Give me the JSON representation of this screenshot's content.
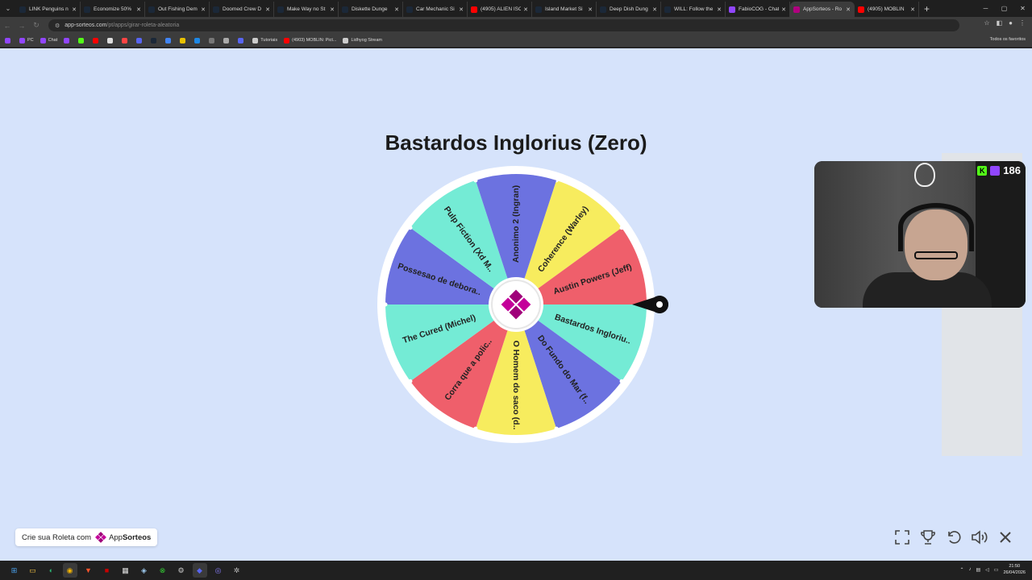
{
  "browser": {
    "tabs": [
      {
        "title": "LINK Penguins n",
        "color": "#1b2838"
      },
      {
        "title": "Economize 50%",
        "color": "#1b2838"
      },
      {
        "title": "Out Fishing Dem",
        "color": "#1b2838"
      },
      {
        "title": "Doomed Crew D",
        "color": "#1b2838"
      },
      {
        "title": "Make Way no St",
        "color": "#1b2838"
      },
      {
        "title": "Diskette Dunge",
        "color": "#1b2838"
      },
      {
        "title": "Car Mechanic Si",
        "color": "#1b2838"
      },
      {
        "title": "(4905) ALIEN ISO",
        "color": "#ff0000"
      },
      {
        "title": "Island Market Si",
        "color": "#1b2838"
      },
      {
        "title": "Deep Dish Dung",
        "color": "#1b2838"
      },
      {
        "title": "WILL: Follow the",
        "color": "#1b2838"
      },
      {
        "title": "FabioCOG - Chat",
        "color": "#9146ff"
      },
      {
        "title": "AppSorteos - Ro",
        "color": "#b0007f",
        "active": true
      },
      {
        "title": "(4905) MOBLIN",
        "color": "#ff0000"
      }
    ],
    "url_host": "app-sorteos.com",
    "url_path": "/pt/apps/girar-roleta-aleatoria",
    "bookmarks": [
      {
        "label": "",
        "color": "#9146ff"
      },
      {
        "label": "PC",
        "color": "#9146ff"
      },
      {
        "label": "Chat",
        "color": "#9146ff"
      },
      {
        "label": "",
        "color": "#9146ff"
      },
      {
        "label": "",
        "color": "#53fc18"
      },
      {
        "label": "",
        "color": "#ff0000"
      },
      {
        "label": "",
        "color": "#dddddd"
      },
      {
        "label": "",
        "color": "#ff4444"
      },
      {
        "label": "",
        "color": "#5865f2"
      },
      {
        "label": "",
        "color": "#1b2838"
      },
      {
        "label": "",
        "color": "#4285f4"
      },
      {
        "label": "",
        "color": "#e8c100"
      },
      {
        "label": "",
        "color": "#1e88e5"
      },
      {
        "label": "",
        "color": "#777777"
      },
      {
        "label": "",
        "color": "#aaaaaa"
      },
      {
        "label": "",
        "color": "#5865f2"
      },
      {
        "label": "Tutoriais",
        "color": "#cccccc"
      },
      {
        "label": "(4903) MOBLIN: Pict...",
        "color": "#ff0000"
      },
      {
        "label": "Lidhyog Stream",
        "color": "#cccccc"
      }
    ],
    "all_bookmarks": "Todos os favoritos"
  },
  "roleta": {
    "title": "Bastardos Inglorius (Zero)",
    "segments": [
      {
        "label": "Coherence (Warley)",
        "color": "#f7ec5e"
      },
      {
        "label": "Austin Powers (Jeff)",
        "color": "#ef5f6b"
      },
      {
        "label": "Bastardos Ingloriu..",
        "color": "#74ebd5"
      },
      {
        "label": "Do Fundo do Mar (f..",
        "color": "#6c72e0"
      },
      {
        "label": "O Homem do saco (d..",
        "color": "#f7ec5e"
      },
      {
        "label": "Corra que a polic..",
        "color": "#ef5f6b"
      },
      {
        "label": "The Cured (Michel)",
        "color": "#74ebd5"
      },
      {
        "label": "Possesao de debora..",
        "color": "#6c72e0"
      },
      {
        "label": "Pulp Fiction (Xd M..",
        "color": "#74ebd5"
      },
      {
        "label": "Anonimo 2 (Ingran)",
        "color": "#6c72e0"
      }
    ],
    "center_color": "#a0007a",
    "pointer_color": "#111111"
  },
  "webcam": {
    "viewer_count": "186",
    "kick_glyph": "K"
  },
  "promo": {
    "text": "Crie sua Roleta com",
    "brand_plain": "App",
    "brand_bold": "Sorteos"
  },
  "controls": [
    "fullscreen-icon",
    "trophy-icon",
    "reset-icon",
    "volume-icon",
    "close-icon"
  ],
  "taskbar": {
    "time": "21:50",
    "date": "26/04/2026"
  }
}
